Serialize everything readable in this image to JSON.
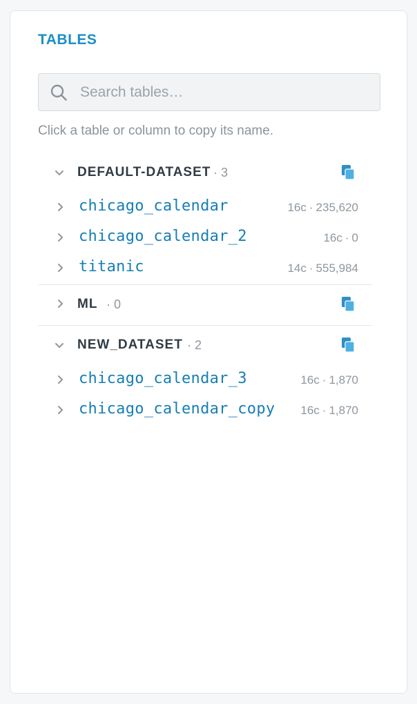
{
  "panel": {
    "title": "TABLES",
    "search": {
      "placeholder": "Search tables…",
      "value": ""
    },
    "hint": "Click a table or column to copy its name."
  },
  "datasets": [
    {
      "name": "DEFAULT-DATASET",
      "count": "· 3",
      "expanded": true,
      "tables": [
        {
          "name": "chicago_calendar",
          "cols": "16c",
          "sep": "·",
          "rows": "235,620"
        },
        {
          "name": "chicago_calendar_2",
          "cols": "16c",
          "sep": "·",
          "rows": "0"
        },
        {
          "name": "titanic",
          "cols": "14c",
          "sep": "·",
          "rows": "555,984"
        }
      ]
    },
    {
      "name": "ML",
      "count": "· 0",
      "expanded": false,
      "tables": []
    },
    {
      "name": "NEW_DATASET",
      "count": "· 2",
      "expanded": true,
      "tables": [
        {
          "name": "chicago_calendar_3",
          "cols": "16c",
          "sep": "·",
          "rows": "1,870"
        },
        {
          "name": "chicago_calendar_copy",
          "cols": "16c",
          "sep": "·",
          "rows": "1,870"
        }
      ]
    }
  ],
  "icons": {
    "search": "search-icon",
    "expanded": "chevron-down-icon",
    "collapsed": "chevron-right-icon",
    "copy": "copy-icon"
  },
  "colors": {
    "accent": "#1c8ec4",
    "table_link": "#167eb5",
    "copy_icon": "#3aa3d8",
    "muted": "#8e979f"
  }
}
